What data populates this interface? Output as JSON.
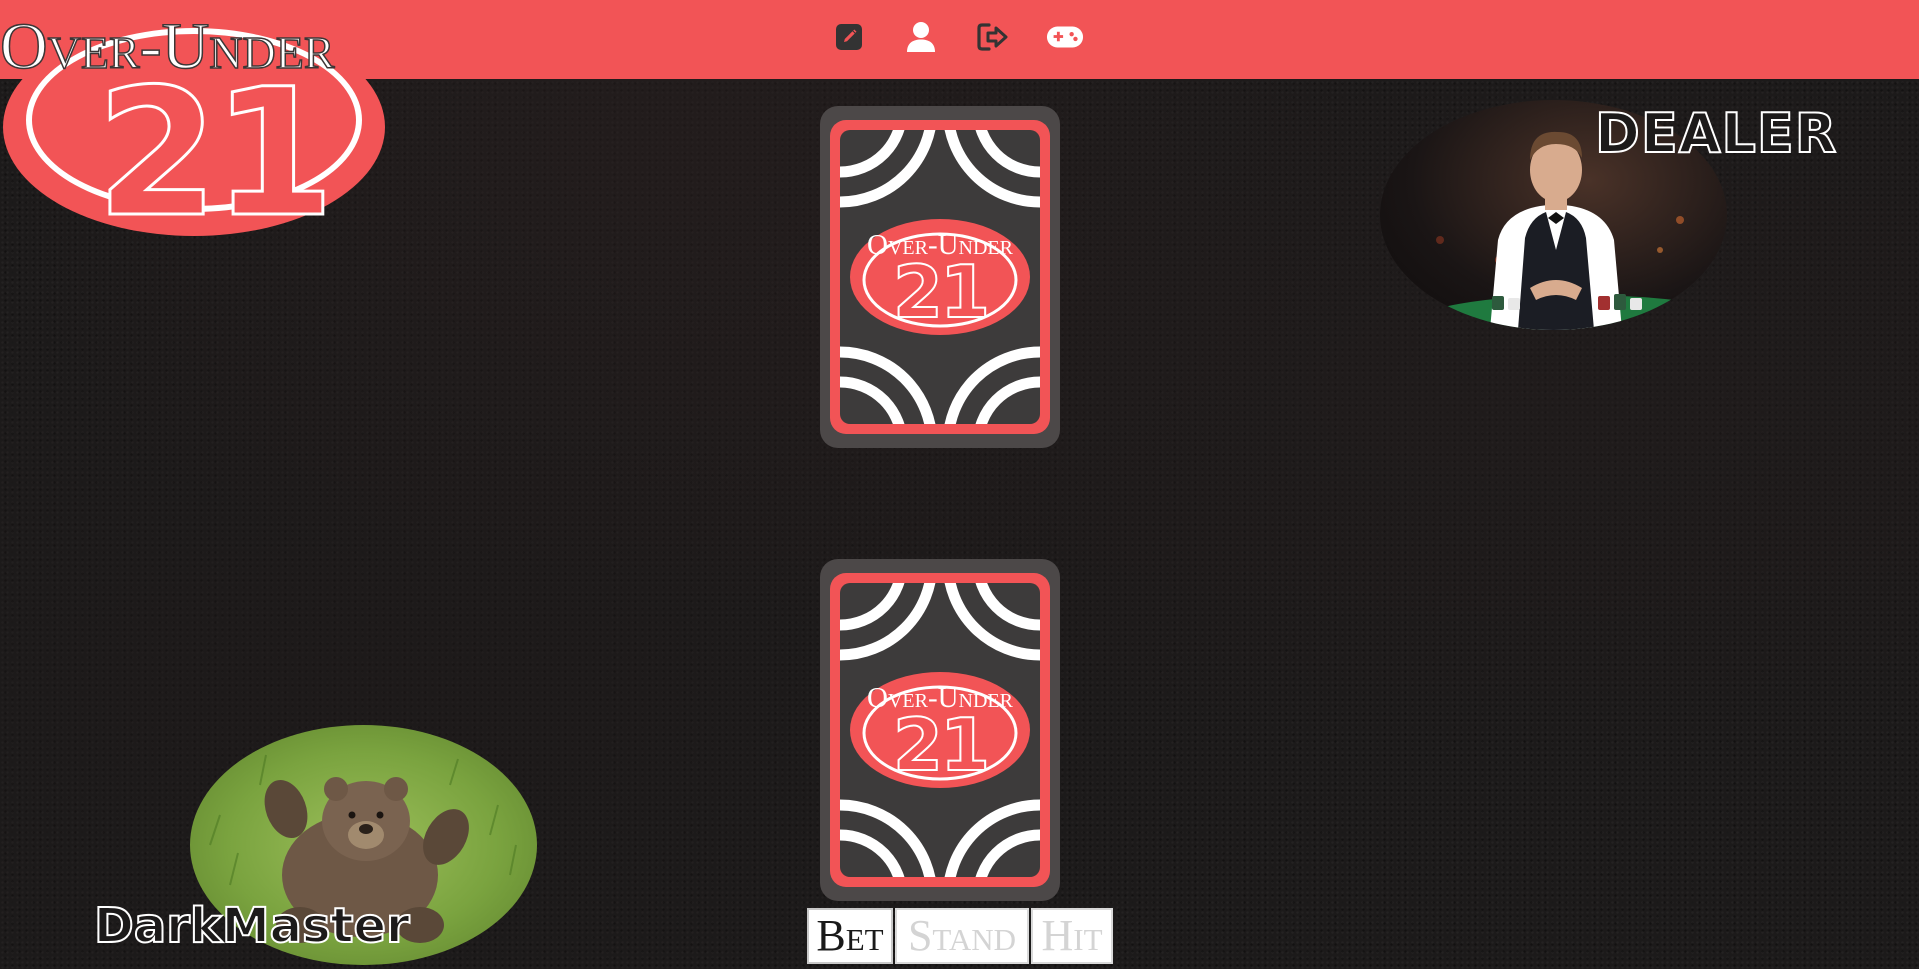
{
  "app": {
    "logo_title": "Over-Under",
    "logo_number": "21"
  },
  "nav": {
    "items": [
      {
        "icon": "edit-icon"
      },
      {
        "icon": "user-icon"
      },
      {
        "icon": "logout-icon"
      },
      {
        "icon": "gamepad-icon"
      }
    ]
  },
  "cards": {
    "dealer_card": {
      "title": "Over-Under",
      "number": "21",
      "face": "back"
    },
    "player_card": {
      "title": "Over-Under",
      "number": "21",
      "face": "back"
    }
  },
  "dealer": {
    "label": "DEALER"
  },
  "player": {
    "name": "DarkMaster"
  },
  "actions": {
    "bet_label": "Bet",
    "stand_label": "Stand",
    "hit_label": "Hit"
  },
  "colors": {
    "brand": "#f25456",
    "card_back": "#3d3b3b",
    "background": "#1c1a1a"
  }
}
